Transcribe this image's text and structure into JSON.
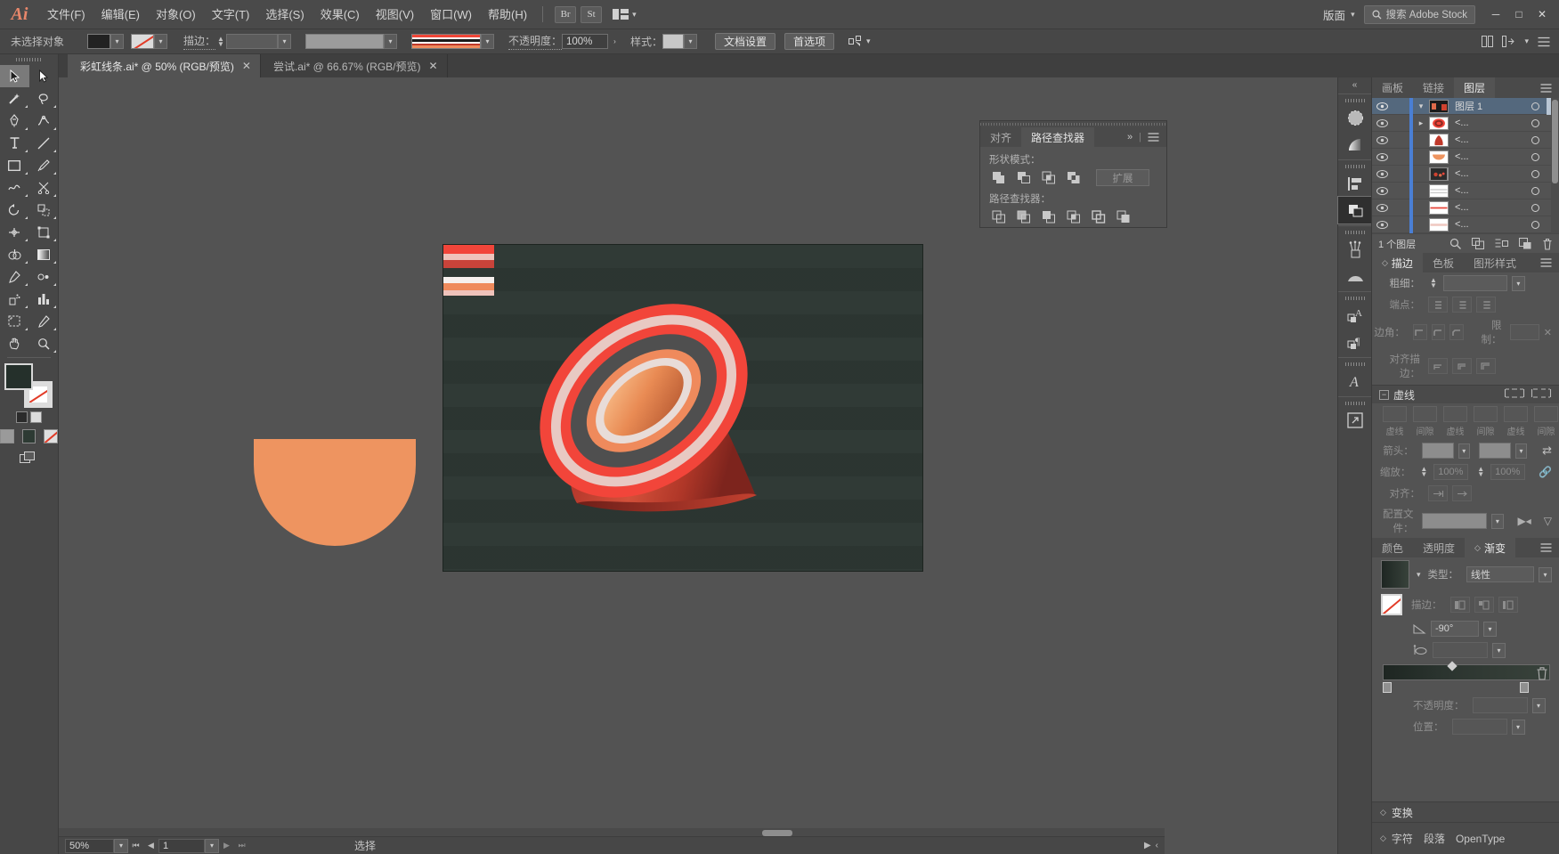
{
  "app": {
    "name": "Ai",
    "window_controls": [
      "minimize",
      "restore",
      "close"
    ]
  },
  "menubar": {
    "items": [
      "文件(F)",
      "编辑(E)",
      "对象(O)",
      "文字(T)",
      "选择(S)",
      "效果(C)",
      "视图(V)",
      "窗口(W)",
      "帮助(H)"
    ],
    "quick_buttons": [
      "Br",
      "St"
    ],
    "arrange_label": "",
    "workspace_label": "版面",
    "search_placeholder": "搜索 Adobe Stock"
  },
  "controlbar": {
    "selection_status": "未选择对象",
    "fill_color": "#25302b",
    "stroke_label": "描边：",
    "stroke_weight_value": "",
    "opacity_label": "不透明度：",
    "opacity_value": "100%",
    "style_label": "样式：",
    "doc_setup_button": "文档设置",
    "preferences_button": "首选项"
  },
  "tabs": [
    {
      "title": "彩虹线条.ai* @ 50% (RGB/预览)",
      "active": true
    },
    {
      "title": "尝试.ai* @ 66.67% (RGB/预览)",
      "active": false
    }
  ],
  "toolbar": {
    "tools": [
      "selection-tool",
      "direct-selection-tool",
      "magic-wand-tool",
      "lasso-tool",
      "pen-tool",
      "curvature-tool",
      "type-tool",
      "line-segment-tool",
      "rectangle-tool",
      "paintbrush-tool",
      "shaper-tool",
      "scissors-tool",
      "rotate-tool",
      "scale-tool",
      "width-tool",
      "free-transform-tool",
      "shape-builder-tool",
      "gradient-tool",
      "eyedropper-tool",
      "blend-tool",
      "symbol-sprayer-tool",
      "column-graph-tool",
      "artboard-tool",
      "slice-tool",
      "hand-tool",
      "zoom-tool"
    ],
    "fill_color": "#25302b",
    "stroke_color": "none"
  },
  "pathfinder_panel": {
    "tabs": [
      {
        "label": "对齐",
        "active": false
      },
      {
        "label": "路径查找器",
        "active": true
      }
    ],
    "shape_modes_label": "形状模式：",
    "shape_modes": [
      "unite",
      "minus-front",
      "intersect",
      "exclude"
    ],
    "expand_button": "扩展",
    "pathfinders_label": "路径查找器：",
    "pathfinders": [
      "divide",
      "trim",
      "merge",
      "crop",
      "outline",
      "minus-back"
    ]
  },
  "rail_icons": [
    "color-panel-icon",
    "gradient-panel-icon",
    "align-panel-icon",
    "pathfinder-panel-icon",
    "brushes-panel-icon",
    "symbols-panel-icon",
    "character-styles-icon",
    "paragraph-styles-icon",
    "glyphs-icon",
    "asset-export-icon"
  ],
  "layers_panel": {
    "tabs": [
      {
        "label": "画板",
        "active": false
      },
      {
        "label": "链接",
        "active": false
      },
      {
        "label": "图层",
        "active": true
      }
    ],
    "rows": [
      {
        "name": "图层 1",
        "selected": true,
        "expanded": true,
        "thumb": "layer-composite",
        "visible": true
      },
      {
        "name": "<...",
        "selected": false,
        "expandable": true,
        "thumb": "red-rings",
        "visible": true
      },
      {
        "name": "<...",
        "selected": false,
        "thumb": "red-cone",
        "visible": true
      },
      {
        "name": "<...",
        "selected": false,
        "thumb": "orange-half-circle",
        "visible": true
      },
      {
        "name": "<...",
        "selected": false,
        "thumb": "red-speckle",
        "visible": true
      },
      {
        "name": "<...",
        "selected": false,
        "thumb": "white-stripes",
        "visible": true
      },
      {
        "name": "<...",
        "selected": false,
        "thumb": "red-line",
        "visible": true
      },
      {
        "name": "<...",
        "selected": false,
        "thumb": "pink-line",
        "visible": true
      }
    ],
    "footer_count": "1 个图层",
    "footer_icons": [
      "locate-object-icon",
      "make-sublayer-icon",
      "create-new-sublayer-icon",
      "create-new-layer-icon",
      "delete-selection-icon"
    ]
  },
  "stroke_panel": {
    "tabs": [
      {
        "label": "描边",
        "active": true
      },
      {
        "label": "色板",
        "active": false
      },
      {
        "label": "图形样式",
        "active": false
      }
    ],
    "weight_label": "粗细：",
    "weight_value": "",
    "cap_label": "端点：",
    "corner_label": "边角：",
    "limit_label": "限制：",
    "align_label": "对齐描边：",
    "dashed_label": "虚线",
    "dash_fields": [
      "虚线",
      "间隙",
      "虚线",
      "间隙",
      "虚线",
      "间隙"
    ],
    "arrow_label": "箭头：",
    "scale_label": "缩放：",
    "scale_value_1": "100%",
    "scale_value_2": "100%",
    "align_arrow_label": "对齐：",
    "profile_label": "配置文件："
  },
  "gradient_panel": {
    "tabs": [
      {
        "label": "颜色",
        "active": false
      },
      {
        "label": "透明度",
        "active": false
      },
      {
        "label": "渐变",
        "active": true
      }
    ],
    "type_label": "类型：",
    "type_value": "线性",
    "stroke_label": "描边：",
    "angle_label": "angle",
    "angle_value": "-90°",
    "aspect_label": "aspect-ratio",
    "opacity_label": "不透明度：",
    "location_label": "位置：",
    "gradient_colors": [
      "#1e2622",
      "#2a332e",
      "#323b35",
      "#38423b"
    ]
  },
  "bottom_panels": {
    "transform": "变换",
    "character": "字符",
    "paragraph": "段落",
    "opentype": "OpenType"
  },
  "statusbar": {
    "zoom_value": "50%",
    "page_value": "1",
    "status_text": "选择"
  },
  "artwork": {
    "artboard_bg": "#2d3733",
    "half_circle_color": "#ee9460",
    "cone_colors": [
      "#b5382c",
      "#d4503a",
      "#ef8a5c",
      "#f4a879"
    ],
    "ring_colors": [
      "#f2453a",
      "#f7b3a6",
      "#4a4a4a",
      "#ef8a5c",
      "#e8dcd8",
      "#f2453a"
    ],
    "stripe_colors": [
      "#f2453a",
      "#efc3bb",
      "#c8433a",
      "#f6f0ee",
      "#ef8a5c",
      "#efc3bb",
      "#ef8a5c"
    ]
  }
}
